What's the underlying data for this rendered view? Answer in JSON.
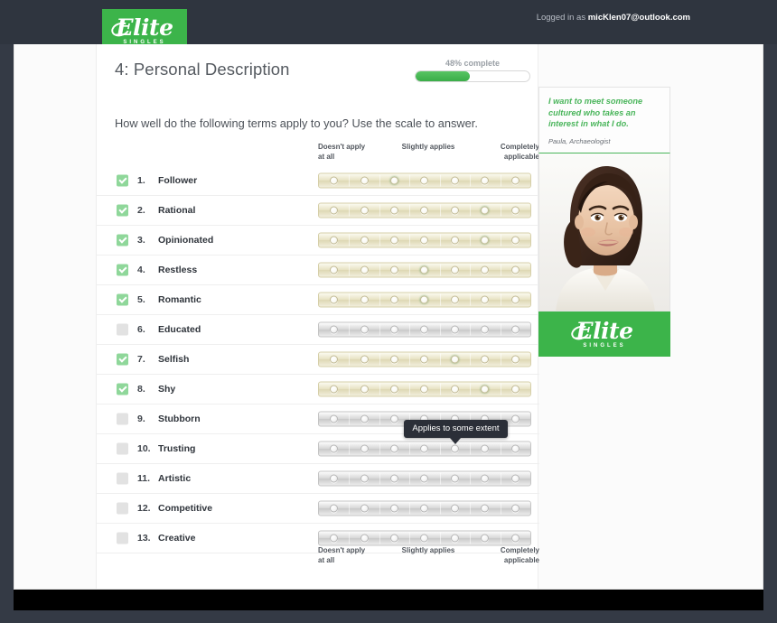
{
  "topbar": {
    "logged_in_prefix": "Logged in as ",
    "account_email": "micKlen07@outlook.com",
    "logo_name": "Elite",
    "logo_sub": "SINGLES"
  },
  "header": {
    "title": "4: Personal Description",
    "progress_label": "48% complete",
    "progress_percent": 48
  },
  "main": {
    "question": "How well do the following terms apply to you? Use the scale to answer.",
    "scale": {
      "left_label": "Doesn't apply at all",
      "mid_label": "Slightly applies",
      "right_label": "Completely applicable",
      "steps": 7
    },
    "tooltip": {
      "text": "Applies to some extent",
      "row_index": 9,
      "step": 5
    },
    "items": [
      {
        "number": "1.",
        "term": "Follower",
        "checked": true,
        "value": 3
      },
      {
        "number": "2.",
        "term": "Rational",
        "checked": true,
        "value": 6
      },
      {
        "number": "3.",
        "term": "Opinionated",
        "checked": true,
        "value": 6
      },
      {
        "number": "4.",
        "term": "Restless",
        "checked": true,
        "value": 4
      },
      {
        "number": "5.",
        "term": "Romantic",
        "checked": true,
        "value": 4
      },
      {
        "number": "6.",
        "term": "Educated",
        "checked": false,
        "value": 0
      },
      {
        "number": "7.",
        "term": "Selfish",
        "checked": true,
        "value": 5
      },
      {
        "number": "8.",
        "term": "Shy",
        "checked": true,
        "value": 6
      },
      {
        "number": "9.",
        "term": "Stubborn",
        "checked": false,
        "value": 0
      },
      {
        "number": "10.",
        "term": "Trusting",
        "checked": false,
        "value": 0
      },
      {
        "number": "11.",
        "term": "Artistic",
        "checked": false,
        "value": 0
      },
      {
        "number": "12.",
        "term": "Competitive",
        "checked": false,
        "value": 0
      },
      {
        "number": "13.",
        "term": "Creative",
        "checked": false,
        "value": 0
      }
    ]
  },
  "sidebar": {
    "quote": "I want to meet someone cultured who takes an interest in what I do.",
    "author": "Paula, Archaeologist",
    "logo_name": "Elite",
    "logo_sub": "SINGLES"
  },
  "colors": {
    "brand_green": "#3cb44a",
    "quote_green": "#4ab55b",
    "dark_chrome": "#2f353f",
    "selected_dot": "#2f9b3f"
  }
}
